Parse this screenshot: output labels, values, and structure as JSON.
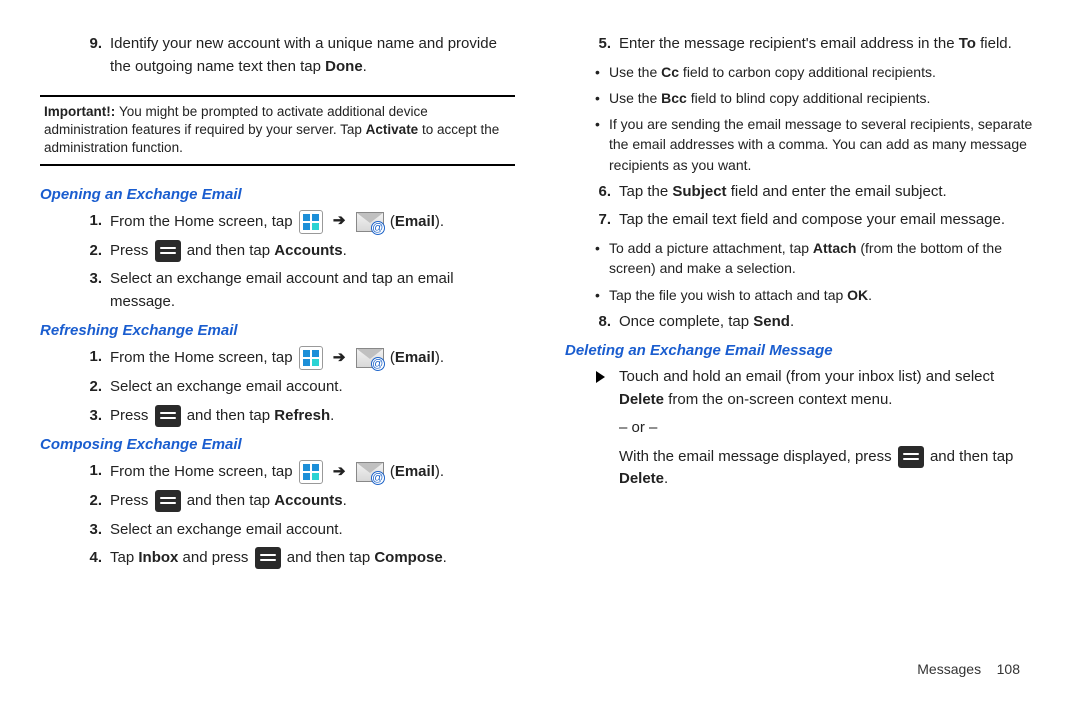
{
  "left": {
    "step9": {
      "num": "9.",
      "text_a": "Identify your new account with a unique name and provide the outgoing name text then tap ",
      "bold": "Done",
      "text_b": "."
    },
    "note": {
      "label": "Important!: ",
      "text_a": "You might be prompted to activate additional device administration features if required by your server. Tap ",
      "bold": "Activate",
      "text_b": " to accept the administration function."
    },
    "h1": "Opening an Exchange Email",
    "open": {
      "s1": {
        "num": "1.",
        "pre": "From the Home screen, tap ",
        "post_a": " (",
        "post_b": "Email",
        "post_c": ")."
      },
      "s2": {
        "num": "2.",
        "pre": "Press ",
        "mid": " and then tap ",
        "bold": "Accounts",
        "post": "."
      },
      "s3": {
        "num": "3.",
        "text": "Select an exchange email account and tap an email message."
      }
    },
    "h2": "Refreshing Exchange Email",
    "refresh": {
      "s1": {
        "num": "1.",
        "pre": "From the Home screen, tap ",
        "post_a": " (",
        "post_b": "Email",
        "post_c": ")."
      },
      "s2": {
        "num": "2.",
        "text": "Select an exchange email account."
      },
      "s3": {
        "num": "3.",
        "pre": "Press ",
        "mid": " and then tap ",
        "bold": "Refresh",
        "post": "."
      }
    },
    "h3": "Composing Exchange Email",
    "compose": {
      "s1": {
        "num": "1.",
        "pre": "From the Home screen, tap ",
        "post_a": " (",
        "post_b": "Email",
        "post_c": ")."
      },
      "s2": {
        "num": "2.",
        "pre": "Press ",
        "mid": " and then tap ",
        "bold": "Accounts",
        "post": "."
      },
      "s3": {
        "num": "3.",
        "text": "Select an exchange email account."
      },
      "s4": {
        "num": "4.",
        "pre": "Tap ",
        "bold1": "Inbox",
        "mid1": " and press ",
        "mid2": " and then tap ",
        "bold2": "Compose",
        "post": "."
      }
    }
  },
  "right": {
    "s5": {
      "num": "5.",
      "pre": "Enter the message recipient's email address in the ",
      "bold": "To",
      "post": " field."
    },
    "b5a": {
      "pre": "Use the ",
      "bold": "Cc",
      "post": " field to carbon copy additional recipients."
    },
    "b5b": {
      "pre": "Use the ",
      "bold": "Bcc",
      "post": " field to blind copy additional recipients."
    },
    "b5c": "If you are sending the email message to several recipients, separate the email addresses with a comma. You can add as many message recipients as you want.",
    "s6": {
      "num": "6.",
      "pre": "Tap the ",
      "bold": "Subject",
      "post": " field and enter the email subject."
    },
    "s7": {
      "num": "7.",
      "text": "Tap the email text field and compose your email message."
    },
    "b7a": {
      "pre": "To add a picture attachment, tap ",
      "bold": "Attach",
      "post": " (from the bottom of the screen) and make a selection."
    },
    "b7b": {
      "pre": "Tap the file you wish to attach and tap ",
      "bold": "OK",
      "post": "."
    },
    "s8": {
      "num": "8.",
      "pre": "Once complete, tap ",
      "bold": "Send",
      "post": "."
    },
    "hdel": "Deleting an Exchange Email Message",
    "del1_a": "Touch and hold an email (from your inbox list) and select ",
    "del1_bold": "Delete",
    "del1_b": " from the on-screen context menu.",
    "or": "– or –",
    "del2_a": "With the email message displayed, press ",
    "del2_b": " and then tap ",
    "del2_bold": "Delete",
    "del2_c": "."
  },
  "footer": {
    "section": "Messages",
    "page": "108"
  }
}
